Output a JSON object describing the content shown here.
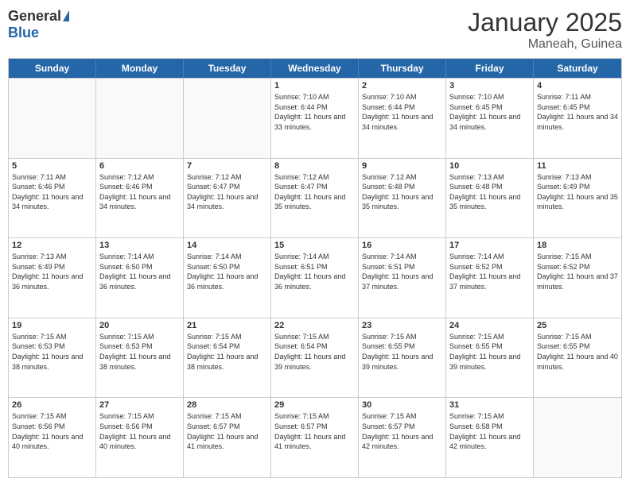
{
  "logo": {
    "general": "General",
    "blue": "Blue"
  },
  "title": "January 2025",
  "location": "Maneah, Guinea",
  "days": [
    "Sunday",
    "Monday",
    "Tuesday",
    "Wednesday",
    "Thursday",
    "Friday",
    "Saturday"
  ],
  "rows": [
    [
      {
        "day": "",
        "info": ""
      },
      {
        "day": "",
        "info": ""
      },
      {
        "day": "",
        "info": ""
      },
      {
        "day": "1",
        "info": "Sunrise: 7:10 AM\nSunset: 6:44 PM\nDaylight: 11 hours and 33 minutes."
      },
      {
        "day": "2",
        "info": "Sunrise: 7:10 AM\nSunset: 6:44 PM\nDaylight: 11 hours and 34 minutes."
      },
      {
        "day": "3",
        "info": "Sunrise: 7:10 AM\nSunset: 6:45 PM\nDaylight: 11 hours and 34 minutes."
      },
      {
        "day": "4",
        "info": "Sunrise: 7:11 AM\nSunset: 6:45 PM\nDaylight: 11 hours and 34 minutes."
      }
    ],
    [
      {
        "day": "5",
        "info": "Sunrise: 7:11 AM\nSunset: 6:46 PM\nDaylight: 11 hours and 34 minutes."
      },
      {
        "day": "6",
        "info": "Sunrise: 7:12 AM\nSunset: 6:46 PM\nDaylight: 11 hours and 34 minutes."
      },
      {
        "day": "7",
        "info": "Sunrise: 7:12 AM\nSunset: 6:47 PM\nDaylight: 11 hours and 34 minutes."
      },
      {
        "day": "8",
        "info": "Sunrise: 7:12 AM\nSunset: 6:47 PM\nDaylight: 11 hours and 35 minutes."
      },
      {
        "day": "9",
        "info": "Sunrise: 7:12 AM\nSunset: 6:48 PM\nDaylight: 11 hours and 35 minutes."
      },
      {
        "day": "10",
        "info": "Sunrise: 7:13 AM\nSunset: 6:48 PM\nDaylight: 11 hours and 35 minutes."
      },
      {
        "day": "11",
        "info": "Sunrise: 7:13 AM\nSunset: 6:49 PM\nDaylight: 11 hours and 35 minutes."
      }
    ],
    [
      {
        "day": "12",
        "info": "Sunrise: 7:13 AM\nSunset: 6:49 PM\nDaylight: 11 hours and 36 minutes."
      },
      {
        "day": "13",
        "info": "Sunrise: 7:14 AM\nSunset: 6:50 PM\nDaylight: 11 hours and 36 minutes."
      },
      {
        "day": "14",
        "info": "Sunrise: 7:14 AM\nSunset: 6:50 PM\nDaylight: 11 hours and 36 minutes."
      },
      {
        "day": "15",
        "info": "Sunrise: 7:14 AM\nSunset: 6:51 PM\nDaylight: 11 hours and 36 minutes."
      },
      {
        "day": "16",
        "info": "Sunrise: 7:14 AM\nSunset: 6:51 PM\nDaylight: 11 hours and 37 minutes."
      },
      {
        "day": "17",
        "info": "Sunrise: 7:14 AM\nSunset: 6:52 PM\nDaylight: 11 hours and 37 minutes."
      },
      {
        "day": "18",
        "info": "Sunrise: 7:15 AM\nSunset: 6:52 PM\nDaylight: 11 hours and 37 minutes."
      }
    ],
    [
      {
        "day": "19",
        "info": "Sunrise: 7:15 AM\nSunset: 6:53 PM\nDaylight: 11 hours and 38 minutes."
      },
      {
        "day": "20",
        "info": "Sunrise: 7:15 AM\nSunset: 6:53 PM\nDaylight: 11 hours and 38 minutes."
      },
      {
        "day": "21",
        "info": "Sunrise: 7:15 AM\nSunset: 6:54 PM\nDaylight: 11 hours and 38 minutes."
      },
      {
        "day": "22",
        "info": "Sunrise: 7:15 AM\nSunset: 6:54 PM\nDaylight: 11 hours and 39 minutes."
      },
      {
        "day": "23",
        "info": "Sunrise: 7:15 AM\nSunset: 6:55 PM\nDaylight: 11 hours and 39 minutes."
      },
      {
        "day": "24",
        "info": "Sunrise: 7:15 AM\nSunset: 6:55 PM\nDaylight: 11 hours and 39 minutes."
      },
      {
        "day": "25",
        "info": "Sunrise: 7:15 AM\nSunset: 6:55 PM\nDaylight: 11 hours and 40 minutes."
      }
    ],
    [
      {
        "day": "26",
        "info": "Sunrise: 7:15 AM\nSunset: 6:56 PM\nDaylight: 11 hours and 40 minutes."
      },
      {
        "day": "27",
        "info": "Sunrise: 7:15 AM\nSunset: 6:56 PM\nDaylight: 11 hours and 40 minutes."
      },
      {
        "day": "28",
        "info": "Sunrise: 7:15 AM\nSunset: 6:57 PM\nDaylight: 11 hours and 41 minutes."
      },
      {
        "day": "29",
        "info": "Sunrise: 7:15 AM\nSunset: 6:57 PM\nDaylight: 11 hours and 41 minutes."
      },
      {
        "day": "30",
        "info": "Sunrise: 7:15 AM\nSunset: 6:57 PM\nDaylight: 11 hours and 42 minutes."
      },
      {
        "day": "31",
        "info": "Sunrise: 7:15 AM\nSunset: 6:58 PM\nDaylight: 11 hours and 42 minutes."
      },
      {
        "day": "",
        "info": ""
      }
    ]
  ]
}
